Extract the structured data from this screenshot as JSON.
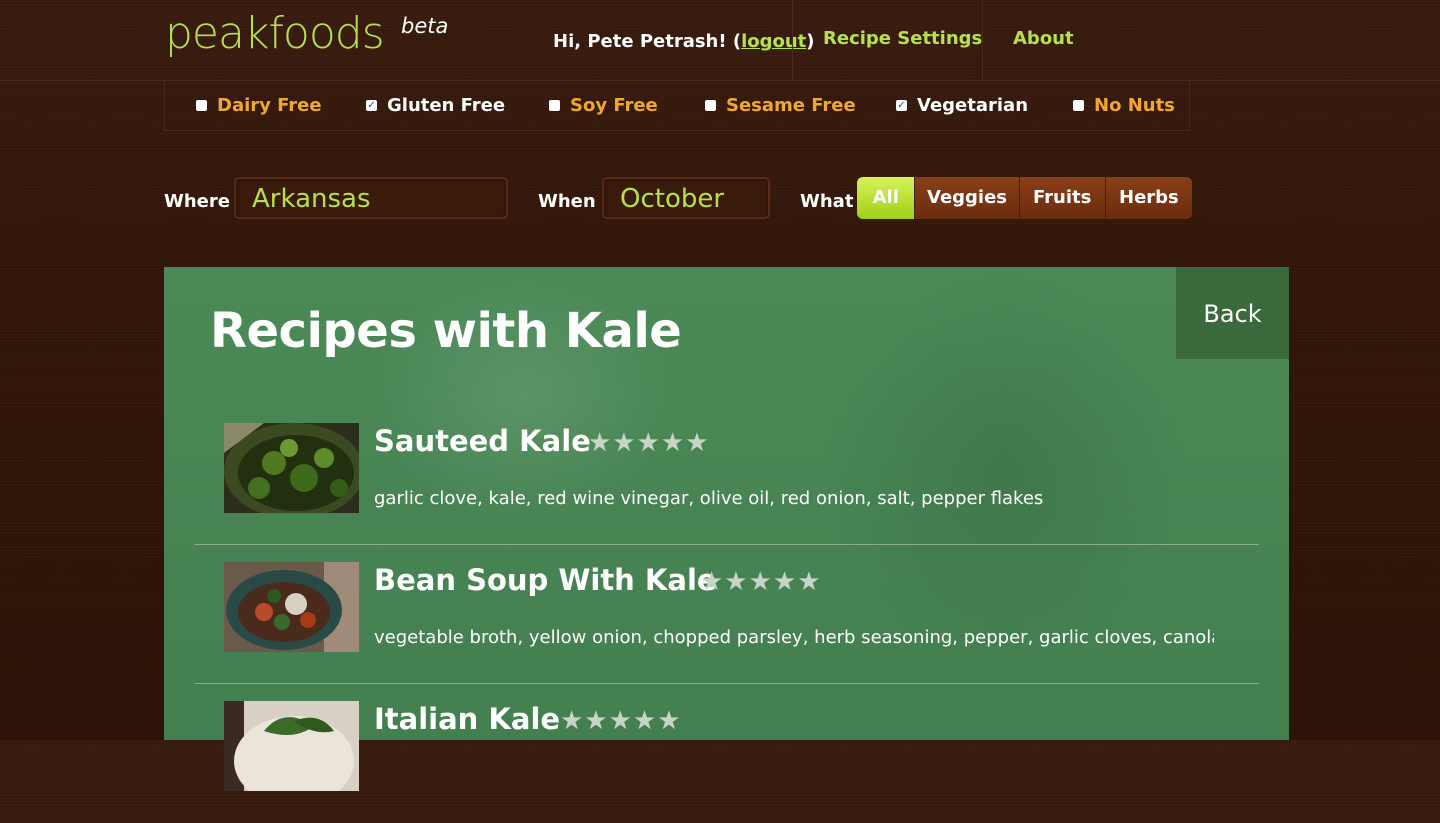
{
  "header": {
    "logo": "peakfoods",
    "beta": "beta",
    "greeting_prefix": "Hi, Pete Petrash! (",
    "logout": "logout",
    "greeting_suffix": ")",
    "nav": [
      "Recipe Settings",
      "About"
    ]
  },
  "filters": [
    {
      "label": "Dairy Free",
      "checked": false
    },
    {
      "label": "Gluten Free",
      "checked": true
    },
    {
      "label": "Soy Free",
      "checked": false
    },
    {
      "label": "Sesame Free",
      "checked": false
    },
    {
      "label": "Vegetarian",
      "checked": true
    },
    {
      "label": "No Nuts",
      "checked": false
    }
  ],
  "search": {
    "where_label": "Where",
    "where_value": "Arkansas",
    "when_label": "When",
    "when_value": "October",
    "what_label": "What",
    "what_options": [
      "All",
      "Veggies",
      "Fruits",
      "Herbs"
    ],
    "what_selected": "All"
  },
  "panel": {
    "title": "Recipes with Kale",
    "back": "Back"
  },
  "recipes": [
    {
      "name": "Sauteed Kale",
      "rating_stars": "★★★★★",
      "rating": 5,
      "ingredients": "garlic clove, kale, red wine vinegar, olive oil, red onion, salt, pepper flakes"
    },
    {
      "name": "Bean Soup With Kale",
      "rating_stars": "★★★★★",
      "rating": 5,
      "ingredients": "vegetable broth, yellow onion, chopped parsley, herb seasoning, pepper, garlic cloves, canola oil, k..."
    },
    {
      "name": "Italian Kale",
      "rating_stars": "★★★★★",
      "rating": 4.5,
      "ingredients": ""
    }
  ],
  "colors": {
    "accent_green": "#b5e24a",
    "filter_orange": "#f0a830",
    "panel_green": "#4b8a57",
    "background_brown": "#331709"
  }
}
